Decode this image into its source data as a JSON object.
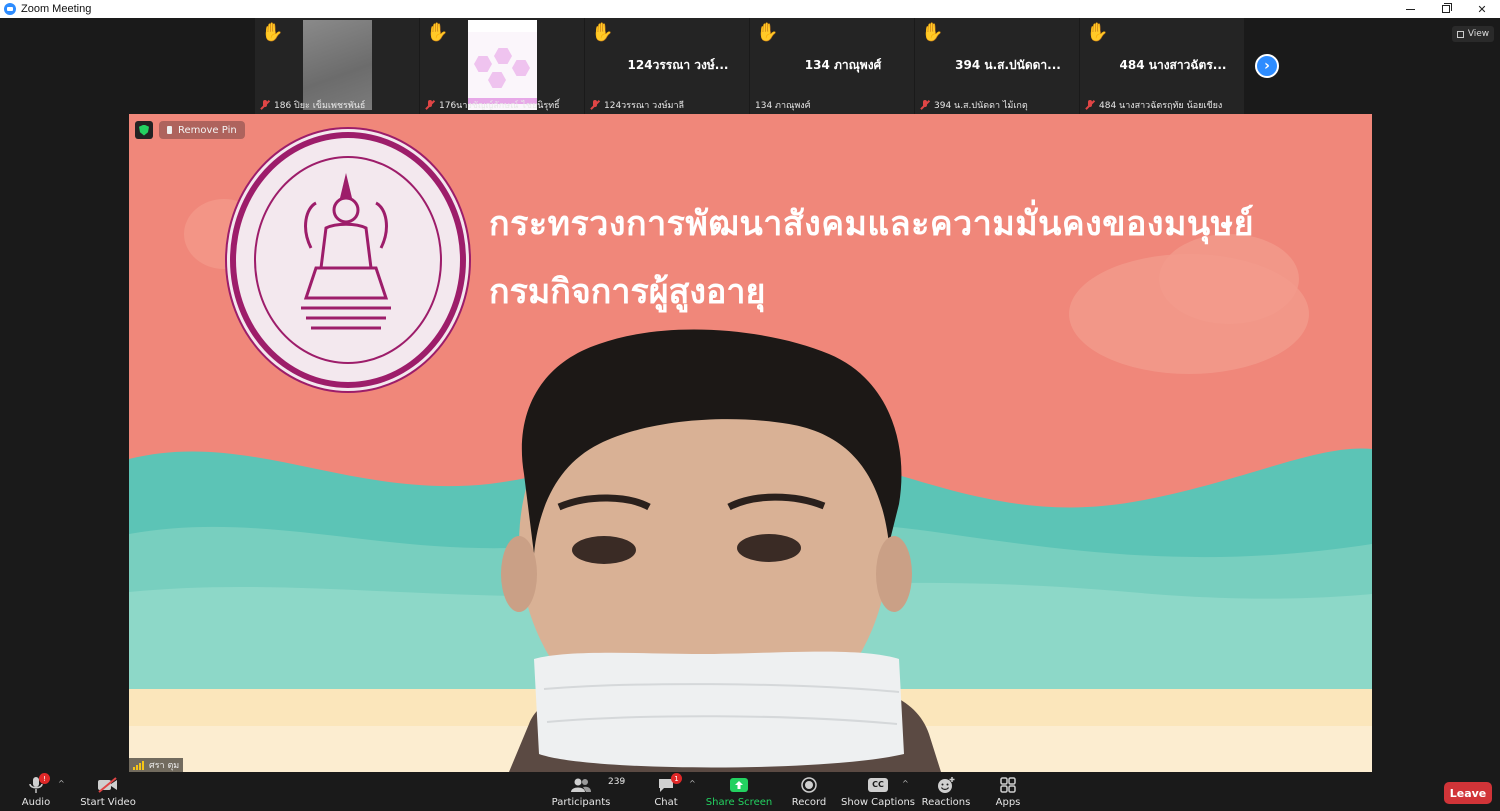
{
  "window": {
    "title": "Zoom Meeting",
    "controls": [
      "minimize",
      "restore",
      "close"
    ],
    "close_glyph": "✕"
  },
  "gallery": {
    "thumbnails": [
      {
        "footer": "186 ปิยะ เข็มเพชรพันธ์",
        "type": "video-grey",
        "raised_hand": true
      },
      {
        "footer": "176นางชัญญ์ลักษณ์ ไชยนิรุทธิ์",
        "type": "video-slide",
        "raised_hand": true
      },
      {
        "big_name": "124วรรณา  วงษ์...",
        "footer": "124วรรณา  วงษ์มาลี",
        "type": "name",
        "raised_hand": true
      },
      {
        "big_name": "134 ภาณุพงศ์",
        "footer": "134 ภาณุพงศ์",
        "type": "name",
        "raised_hand": true
      },
      {
        "big_name": "394 น.ส.ปนัดดา...",
        "footer": "394 น.ส.ปนัดดา ไม้เกตุ",
        "type": "name",
        "raised_hand": true
      },
      {
        "big_name": "484 นางสาวฉัตร...",
        "footer": "484 นางสาวฉัตรฤทัย น้อยเขียง",
        "type": "name",
        "raised_hand": true
      }
    ],
    "next_page_icon": "chevron-right-icon",
    "view_label": "View"
  },
  "main_video": {
    "remove_pin_label": "Remove Pin",
    "headline_line1": "กระทรวงการพัฒนาสังคมและความมั่นคงของมนุษย์",
    "headline_line2": "กรมกิจการผู้สูงอายุ",
    "speaker_name": "ศรา ตุม"
  },
  "toolbar": {
    "audio": {
      "label": "Audio",
      "badge": "!"
    },
    "video": {
      "label": "Start Video"
    },
    "participants": {
      "label": "Participants",
      "count": "239"
    },
    "chat": {
      "label": "Chat",
      "badge": "1"
    },
    "share": {
      "label": "Share Screen"
    },
    "record": {
      "label": "Record"
    },
    "captions": {
      "label": "Show Captions",
      "icon_text": "CC"
    },
    "reactions": {
      "label": "Reactions"
    },
    "apps": {
      "label": "Apps"
    },
    "leave": {
      "label": "Leave"
    }
  },
  "colors": {
    "accent": "#2d8cff",
    "leave": "#d13438",
    "share": "#23d160",
    "hand": "#f5c518",
    "background": "#f0877a",
    "teal": "#5cc4b6",
    "sand": "#fbe6bb",
    "seal": "#9d1d6a"
  }
}
